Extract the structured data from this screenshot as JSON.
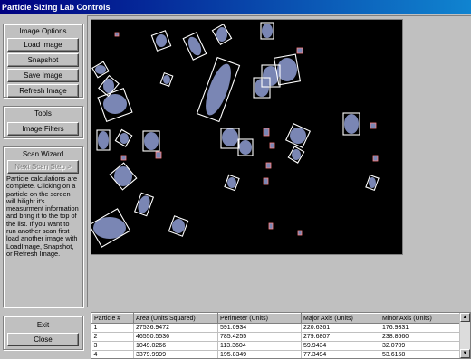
{
  "window": {
    "title": "Particle Sizing Lab Controls"
  },
  "image_options": {
    "title": "Image Options",
    "buttons": [
      "Load Image",
      "Snapshot",
      "Save Image",
      "Refresh Image"
    ]
  },
  "tools": {
    "title": "Tools",
    "image_filters_label": "Image Filters"
  },
  "scan_wizard": {
    "title": "Scan Wizard",
    "next_step_label": "Next Scan Step >",
    "message": "Particle calculations are complete. Clicking on a particle on the screen will hilight it's measurment information and bring it to the top of the list. If you want to run another scan first load another image with LoadImage, Snapshot, or Refresh Image."
  },
  "exit": {
    "title": "Exit",
    "close_label": "Close"
  },
  "results_table": {
    "headers": [
      "Particle #",
      "Area (Units Squared)",
      "Perimeter (Units)",
      "Major Axis (Units)",
      "Minor Axis (Units)"
    ],
    "rows": [
      [
        "1",
        "27536.9472",
        "591.0934",
        "220.6361",
        "176.9331"
      ],
      [
        "2",
        "46550.5536",
        "785.4255",
        "279.6807",
        "238.8660"
      ],
      [
        "3",
        "1049.0266",
        "113.3604",
        "59.9434",
        "32.0709"
      ],
      [
        "4",
        "3379.9999",
        "195.8349",
        "77.3494",
        "53.6158"
      ]
    ]
  },
  "colors": {
    "titlebar": "#000080",
    "particle_fill": "#7a86b4",
    "bbox": "#ffffff",
    "accent": "#ff8080"
  }
}
